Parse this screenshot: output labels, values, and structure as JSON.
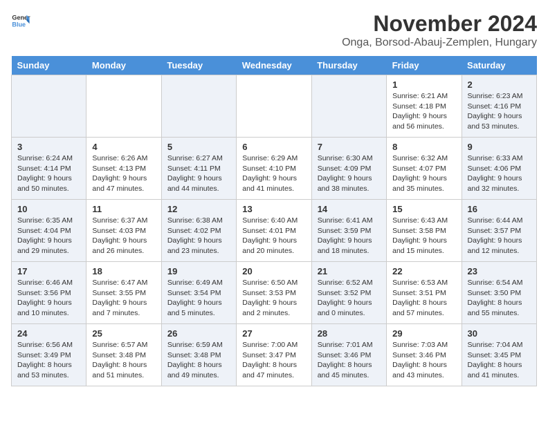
{
  "header": {
    "logo_line1": "General",
    "logo_line2": "Blue",
    "title": "November 2024",
    "subtitle": "Onga, Borsod-Abauj-Zemplen, Hungary"
  },
  "days_of_week": [
    "Sunday",
    "Monday",
    "Tuesday",
    "Wednesday",
    "Thursday",
    "Friday",
    "Saturday"
  ],
  "weeks": [
    {
      "days": [
        {
          "number": "",
          "info": ""
        },
        {
          "number": "",
          "info": ""
        },
        {
          "number": "",
          "info": ""
        },
        {
          "number": "",
          "info": ""
        },
        {
          "number": "",
          "info": ""
        },
        {
          "number": "1",
          "info": "Sunrise: 6:21 AM\nSunset: 4:18 PM\nDaylight: 9 hours and 56 minutes."
        },
        {
          "number": "2",
          "info": "Sunrise: 6:23 AM\nSunset: 4:16 PM\nDaylight: 9 hours and 53 minutes."
        }
      ]
    },
    {
      "days": [
        {
          "number": "3",
          "info": "Sunrise: 6:24 AM\nSunset: 4:14 PM\nDaylight: 9 hours and 50 minutes."
        },
        {
          "number": "4",
          "info": "Sunrise: 6:26 AM\nSunset: 4:13 PM\nDaylight: 9 hours and 47 minutes."
        },
        {
          "number": "5",
          "info": "Sunrise: 6:27 AM\nSunset: 4:11 PM\nDaylight: 9 hours and 44 minutes."
        },
        {
          "number": "6",
          "info": "Sunrise: 6:29 AM\nSunset: 4:10 PM\nDaylight: 9 hours and 41 minutes."
        },
        {
          "number": "7",
          "info": "Sunrise: 6:30 AM\nSunset: 4:09 PM\nDaylight: 9 hours and 38 minutes."
        },
        {
          "number": "8",
          "info": "Sunrise: 6:32 AM\nSunset: 4:07 PM\nDaylight: 9 hours and 35 minutes."
        },
        {
          "number": "9",
          "info": "Sunrise: 6:33 AM\nSunset: 4:06 PM\nDaylight: 9 hours and 32 minutes."
        }
      ]
    },
    {
      "days": [
        {
          "number": "10",
          "info": "Sunrise: 6:35 AM\nSunset: 4:04 PM\nDaylight: 9 hours and 29 minutes."
        },
        {
          "number": "11",
          "info": "Sunrise: 6:37 AM\nSunset: 4:03 PM\nDaylight: 9 hours and 26 minutes."
        },
        {
          "number": "12",
          "info": "Sunrise: 6:38 AM\nSunset: 4:02 PM\nDaylight: 9 hours and 23 minutes."
        },
        {
          "number": "13",
          "info": "Sunrise: 6:40 AM\nSunset: 4:01 PM\nDaylight: 9 hours and 20 minutes."
        },
        {
          "number": "14",
          "info": "Sunrise: 6:41 AM\nSunset: 3:59 PM\nDaylight: 9 hours and 18 minutes."
        },
        {
          "number": "15",
          "info": "Sunrise: 6:43 AM\nSunset: 3:58 PM\nDaylight: 9 hours and 15 minutes."
        },
        {
          "number": "16",
          "info": "Sunrise: 6:44 AM\nSunset: 3:57 PM\nDaylight: 9 hours and 12 minutes."
        }
      ]
    },
    {
      "days": [
        {
          "number": "17",
          "info": "Sunrise: 6:46 AM\nSunset: 3:56 PM\nDaylight: 9 hours and 10 minutes."
        },
        {
          "number": "18",
          "info": "Sunrise: 6:47 AM\nSunset: 3:55 PM\nDaylight: 9 hours and 7 minutes."
        },
        {
          "number": "19",
          "info": "Sunrise: 6:49 AM\nSunset: 3:54 PM\nDaylight: 9 hours and 5 minutes."
        },
        {
          "number": "20",
          "info": "Sunrise: 6:50 AM\nSunset: 3:53 PM\nDaylight: 9 hours and 2 minutes."
        },
        {
          "number": "21",
          "info": "Sunrise: 6:52 AM\nSunset: 3:52 PM\nDaylight: 9 hours and 0 minutes."
        },
        {
          "number": "22",
          "info": "Sunrise: 6:53 AM\nSunset: 3:51 PM\nDaylight: 8 hours and 57 minutes."
        },
        {
          "number": "23",
          "info": "Sunrise: 6:54 AM\nSunset: 3:50 PM\nDaylight: 8 hours and 55 minutes."
        }
      ]
    },
    {
      "days": [
        {
          "number": "24",
          "info": "Sunrise: 6:56 AM\nSunset: 3:49 PM\nDaylight: 8 hours and 53 minutes."
        },
        {
          "number": "25",
          "info": "Sunrise: 6:57 AM\nSunset: 3:48 PM\nDaylight: 8 hours and 51 minutes."
        },
        {
          "number": "26",
          "info": "Sunrise: 6:59 AM\nSunset: 3:48 PM\nDaylight: 8 hours and 49 minutes."
        },
        {
          "number": "27",
          "info": "Sunrise: 7:00 AM\nSunset: 3:47 PM\nDaylight: 8 hours and 47 minutes."
        },
        {
          "number": "28",
          "info": "Sunrise: 7:01 AM\nSunset: 3:46 PM\nDaylight: 8 hours and 45 minutes."
        },
        {
          "number": "29",
          "info": "Sunrise: 7:03 AM\nSunset: 3:46 PM\nDaylight: 8 hours and 43 minutes."
        },
        {
          "number": "30",
          "info": "Sunrise: 7:04 AM\nSunset: 3:45 PM\nDaylight: 8 hours and 41 minutes."
        }
      ]
    }
  ]
}
